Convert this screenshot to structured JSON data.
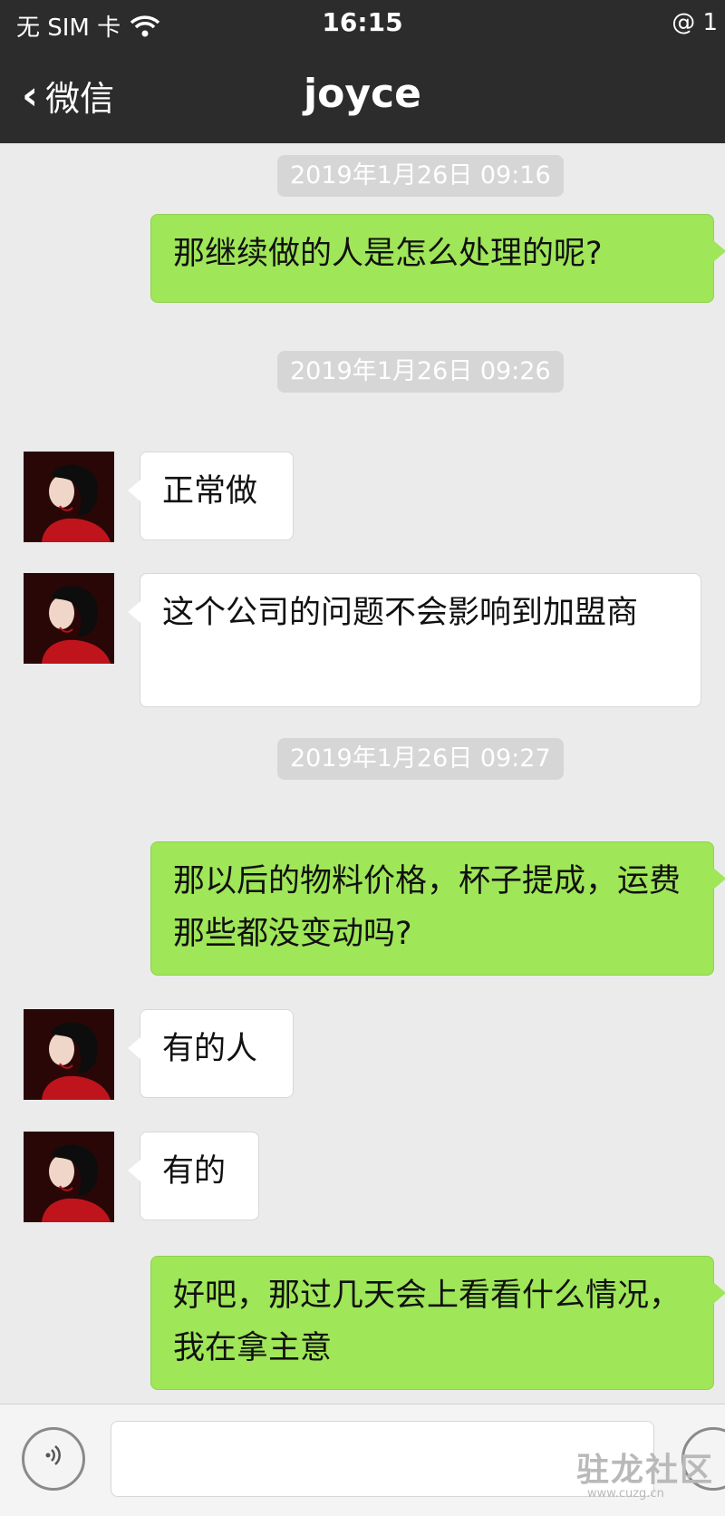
{
  "status_bar": {
    "carrier": "无 SIM 卡",
    "time": "16:15",
    "right_glyph": "@ 1"
  },
  "nav": {
    "back_label": "微信",
    "title": "joyce"
  },
  "messages": [
    {
      "type": "timestamp",
      "text": "2019年1月26日 09:16"
    },
    {
      "type": "outgoing",
      "text": "那继续做的人是怎么处理的呢?"
    },
    {
      "type": "timestamp",
      "text": "2019年1月26日 09:26"
    },
    {
      "type": "incoming",
      "text": "正常做"
    },
    {
      "type": "incoming",
      "text": "这个公司的问题不会影响到加盟商"
    },
    {
      "type": "timestamp",
      "text": "2019年1月26日 09:27"
    },
    {
      "type": "outgoing",
      "text": "那以后的物料价格，杯子提成，运费那些都没变动吗?"
    },
    {
      "type": "incoming",
      "text": "有的人"
    },
    {
      "type": "incoming",
      "text": "有的"
    },
    {
      "type": "outgoing",
      "text": "好吧，那过几天会上看看什么情况，我在拿主意"
    }
  ],
  "watermark": {
    "main": "驻龙社区",
    "sub": "www.cuzg.cn"
  },
  "colors": {
    "nav_bg": "#2c2c2c",
    "chat_bg": "#ebebeb",
    "outgoing_bubble": "#9fe658",
    "incoming_bubble": "#ffffff"
  }
}
